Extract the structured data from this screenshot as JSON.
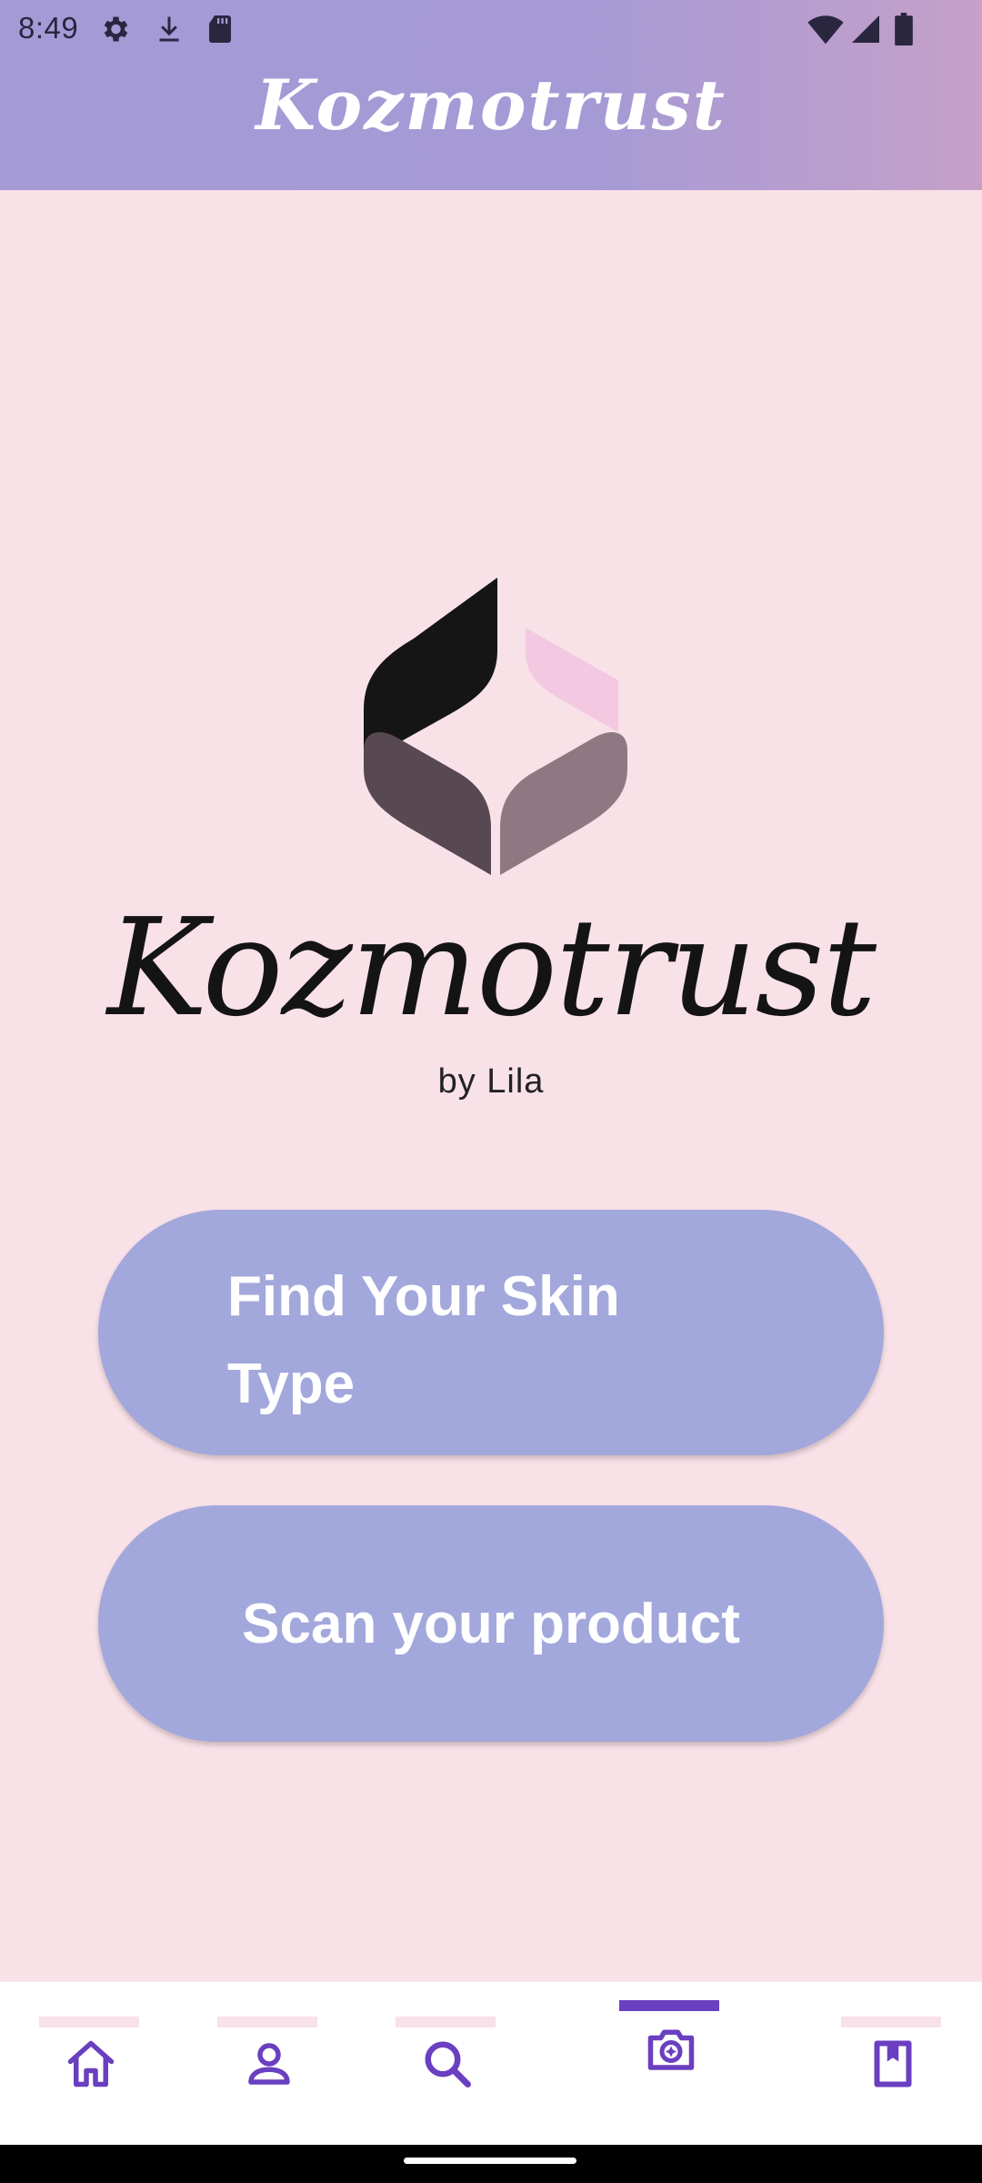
{
  "status_bar": {
    "time": "8:49",
    "left_icons": [
      "gear-icon",
      "download-icon",
      "sd-card-icon"
    ],
    "right_icons": [
      "wifi-icon",
      "signal-icon",
      "battery-icon"
    ]
  },
  "header": {
    "title": "Kozmotrust"
  },
  "brand": {
    "name": "Kozmotrust",
    "subtitle": "by Lila"
  },
  "actions": {
    "skin_type_label": "Find Your Skin Type",
    "scan_label": "Scan your product"
  },
  "bottom_nav": {
    "items": [
      {
        "icon": "home-icon",
        "active": false
      },
      {
        "icon": "profile-icon",
        "active": false
      },
      {
        "icon": "search-icon",
        "active": false
      },
      {
        "icon": "camera-scan-icon",
        "active": true
      },
      {
        "icon": "bookmark-book-icon",
        "active": false
      }
    ]
  },
  "colors": {
    "background": "#f9e1e8",
    "header_gradient_start": "#a49bd6",
    "header_gradient_end": "#c6a0c9",
    "button": "#a2a8db",
    "nav_accent": "#6a3fc0",
    "logo_dark": "#151515",
    "logo_plum": "#574852",
    "logo_mauve": "#907882",
    "logo_pink": "#f2c9e0"
  }
}
